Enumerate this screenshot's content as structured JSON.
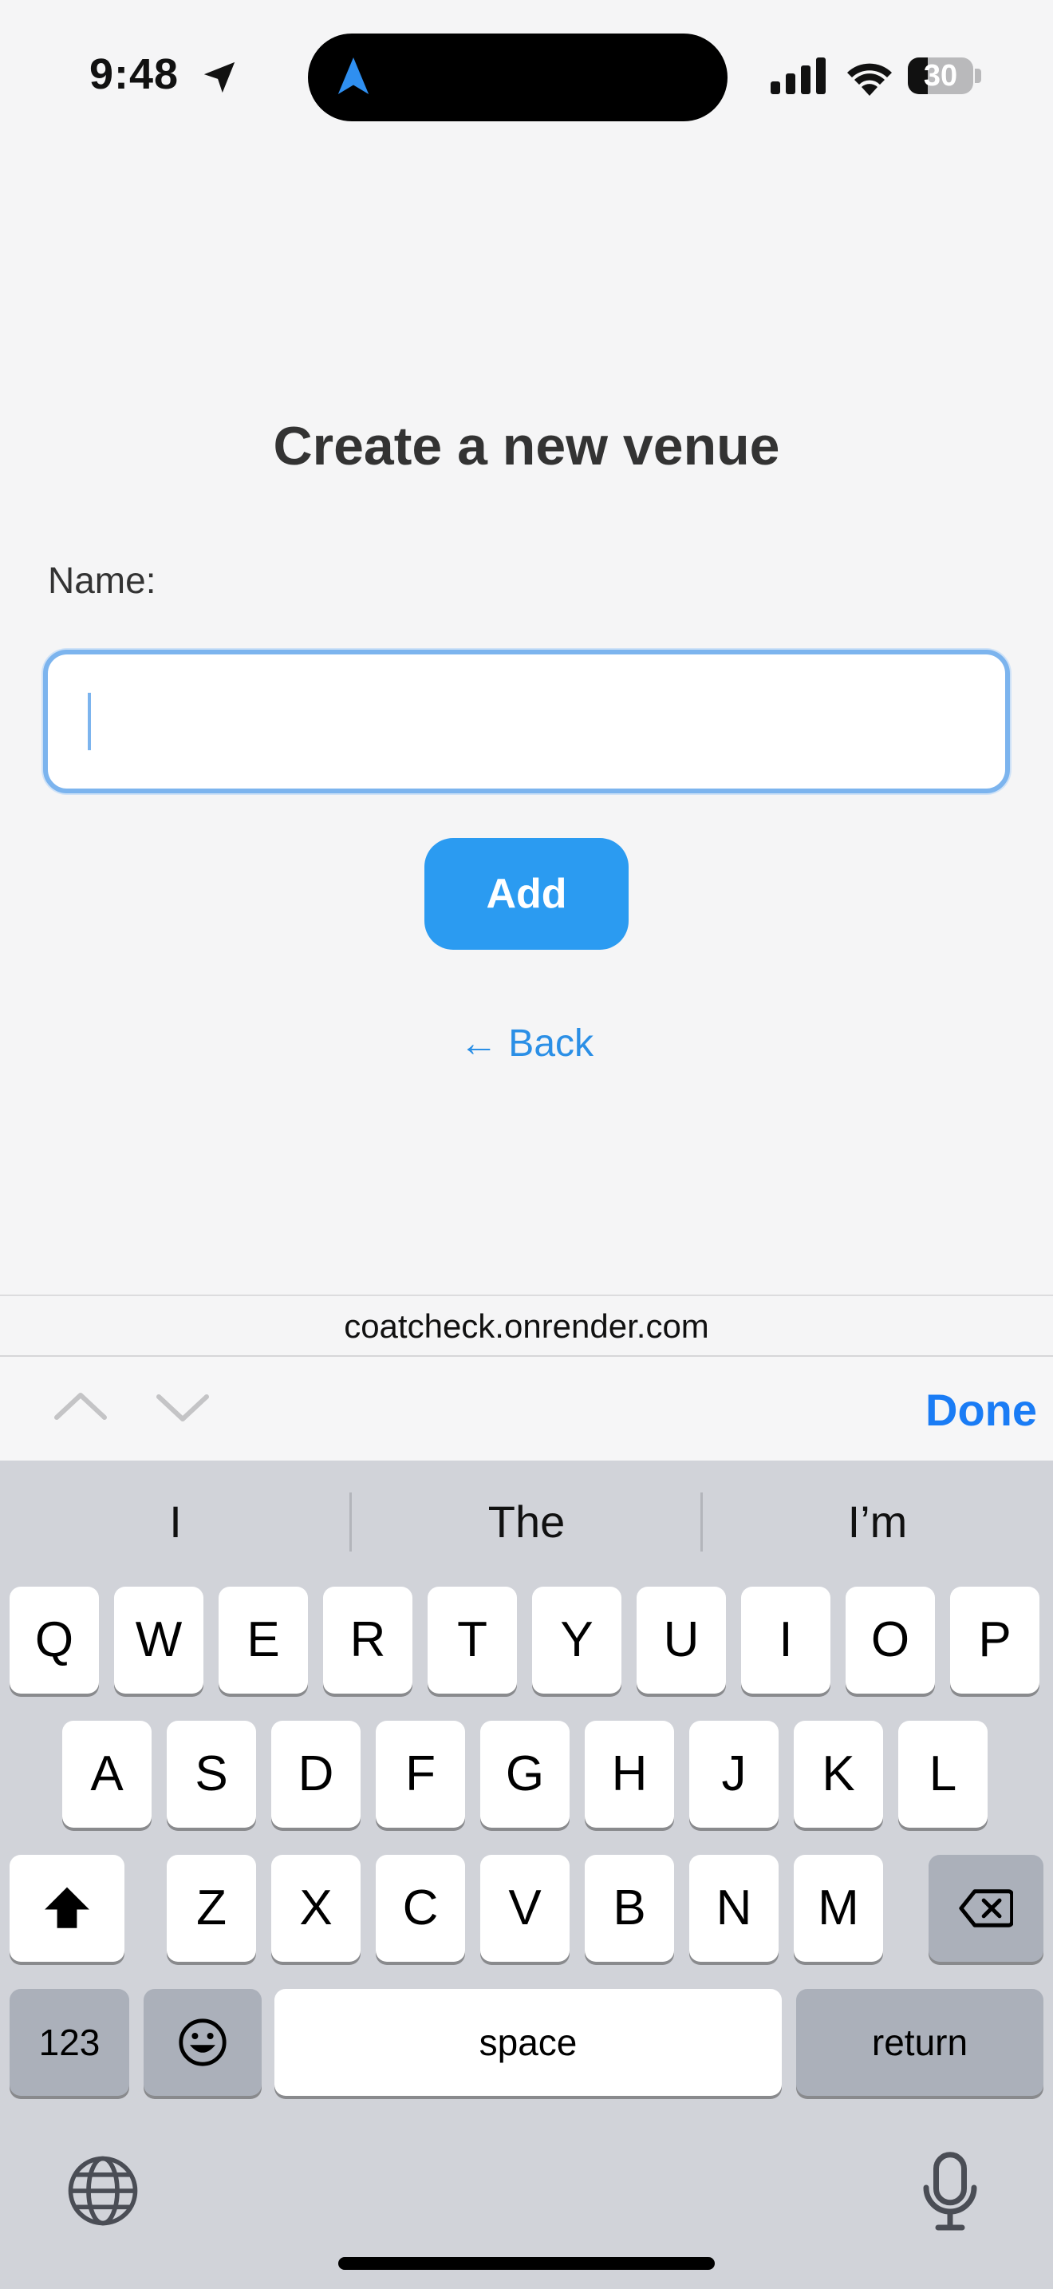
{
  "status_bar": {
    "time": "9:48",
    "battery": "30",
    "battery_level": 0.3
  },
  "page": {
    "title": "Create a new venue",
    "name_label": "Name:",
    "name_value": "",
    "add_label": "Add",
    "back_label": "← Back"
  },
  "browser": {
    "url": "coatcheck.onrender.com"
  },
  "accessory_bar": {
    "done_label": "Done"
  },
  "keyboard": {
    "suggestions": [
      "I",
      "The",
      "I’m"
    ],
    "row1": [
      "Q",
      "W",
      "E",
      "R",
      "T",
      "Y",
      "U",
      "I",
      "O",
      "P"
    ],
    "row2": [
      "A",
      "S",
      "D",
      "F",
      "G",
      "H",
      "J",
      "K",
      "L"
    ],
    "row3": [
      "Z",
      "X",
      "C",
      "V",
      "B",
      "N",
      "M"
    ],
    "numbers_label": "123",
    "space_label": "space",
    "return_label": "return"
  },
  "colors": {
    "accent": "#2b9bf1",
    "link": "#2b8fe6",
    "done": "#1a7cf5",
    "input_focus": "#7cb4ee"
  },
  "icons": {
    "location": "location-arrow-icon",
    "navigation": "navigation-arrow-icon",
    "signal": "cellular-signal-icon",
    "wifi": "wifi-icon",
    "battery": "battery-icon",
    "chevron_up": "chevron-up-icon",
    "chevron_down": "chevron-down-icon",
    "shift": "shift-icon",
    "delete": "backspace-icon",
    "emoji": "emoji-icon",
    "globe": "globe-icon",
    "mic": "microphone-icon"
  }
}
